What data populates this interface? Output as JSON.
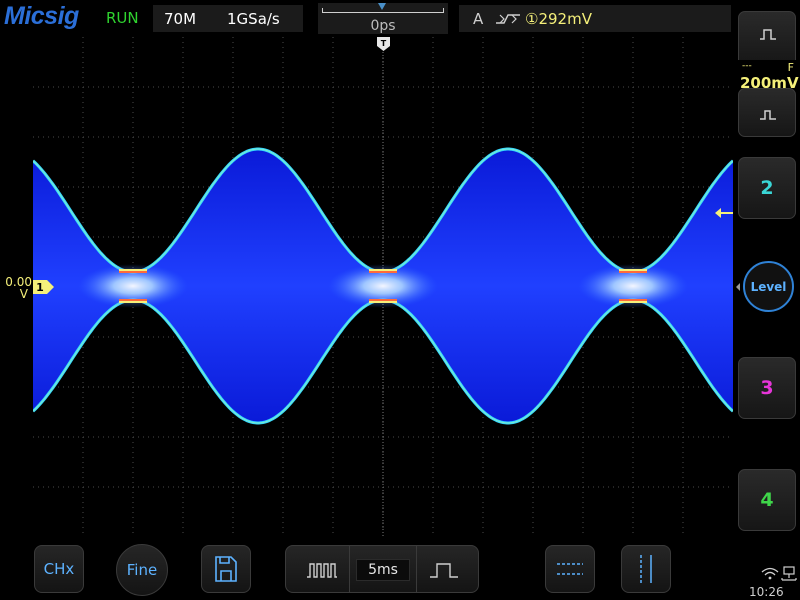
{
  "header": {
    "brand": "Micsig",
    "run_state": "RUN",
    "bandwidth": "70M",
    "sample_rate": "1GSa/s",
    "time_offset": "0ps",
    "trigger_source_prefix": "A",
    "trigger_channel_value": "①292mV"
  },
  "channel1": {
    "offset_value": "0.00",
    "offset_unit": "V",
    "marker": "1",
    "vertical_scale": "200mV",
    "coupling_flag": "F",
    "coupling_symbol": "---"
  },
  "trigger_marker": "T",
  "side_panel": {
    "ch2_label": "2",
    "ch3_label": "3",
    "ch4_label": "4",
    "level_label": "Level"
  },
  "bottom_bar": {
    "chx_label": "CHx",
    "fine_label": "Fine",
    "timebase": "5ms"
  },
  "system": {
    "clock": "10:26"
  },
  "colors": {
    "run": "#2fd32f",
    "ch1": "#f5f07a",
    "ch2": "#3ad6d6",
    "ch3": "#e635d8",
    "ch4": "#3fd64a",
    "accent": "#5db2ff",
    "brand": "#2b6fd8"
  },
  "icons": [
    "save-icon",
    "cursor-horizontal-icon",
    "cursor-vertical-icon",
    "pulse-wide-icon",
    "pulse-narrow-icon",
    "wifi-icon",
    "network-icon",
    "edge-trigger-icon"
  ]
}
